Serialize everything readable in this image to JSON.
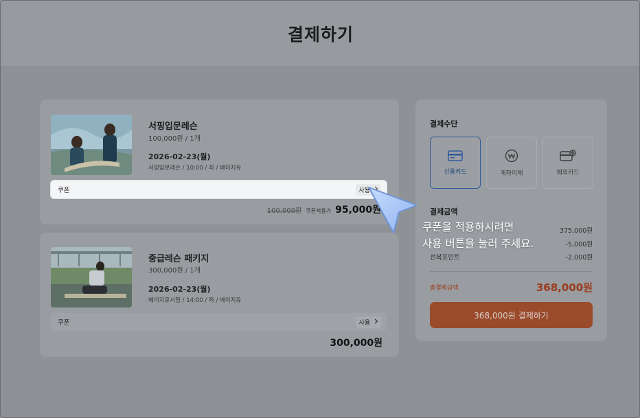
{
  "header": {
    "title": "결제하기"
  },
  "items": [
    {
      "name": "서핑입문레슨",
      "price_qty": "100,000원  / 1개",
      "date": "2026-02-23(월)",
      "detail": "서핑입문레슨 / 10:00 / 좌 / 베이지유",
      "coupon_label": "쿠폰",
      "use_label": "사용",
      "original_price": "100,000원",
      "coupon_applied_label": "쿠폰적용가",
      "final_price": "95,000원"
    },
    {
      "name": "중급레슨 패키지",
      "price_qty": "300,000원  / 1개",
      "date": "2026-02-23(월)",
      "detail": "베이지유서핑 / 14:00 / 좌 / 베이지유",
      "coupon_label": "쿠폰",
      "use_label": "사용",
      "final_price": "300,000원"
    }
  ],
  "summary": {
    "payment_method_title": "결제수단",
    "methods": [
      {
        "label": "신용카드",
        "icon": "credit-card-icon",
        "selected": true
      },
      {
        "label": "계좌이체",
        "icon": "won-coin-icon",
        "selected": false
      },
      {
        "label": "해외카드",
        "icon": "global-card-icon",
        "selected": false
      }
    ],
    "amount_title": "결제금액",
    "rows": [
      {
        "label": "",
        "value": "375,000원"
      },
      {
        "label": "",
        "value": "-5,000원"
      },
      {
        "label": "선복포인트",
        "value": "-2,000원"
      }
    ],
    "total_label": "총결제금액",
    "total_value": "368,000원",
    "pay_button": "368,000원 결제하기"
  },
  "tooltip": {
    "line1": "쿠폰을 적용하시려면",
    "line2": "사용 버튼을 눌러 주세요."
  },
  "colors": {
    "accent": "#d9602b",
    "selected_border": "#2f5a9e",
    "cursor": "#9fc0f5"
  }
}
